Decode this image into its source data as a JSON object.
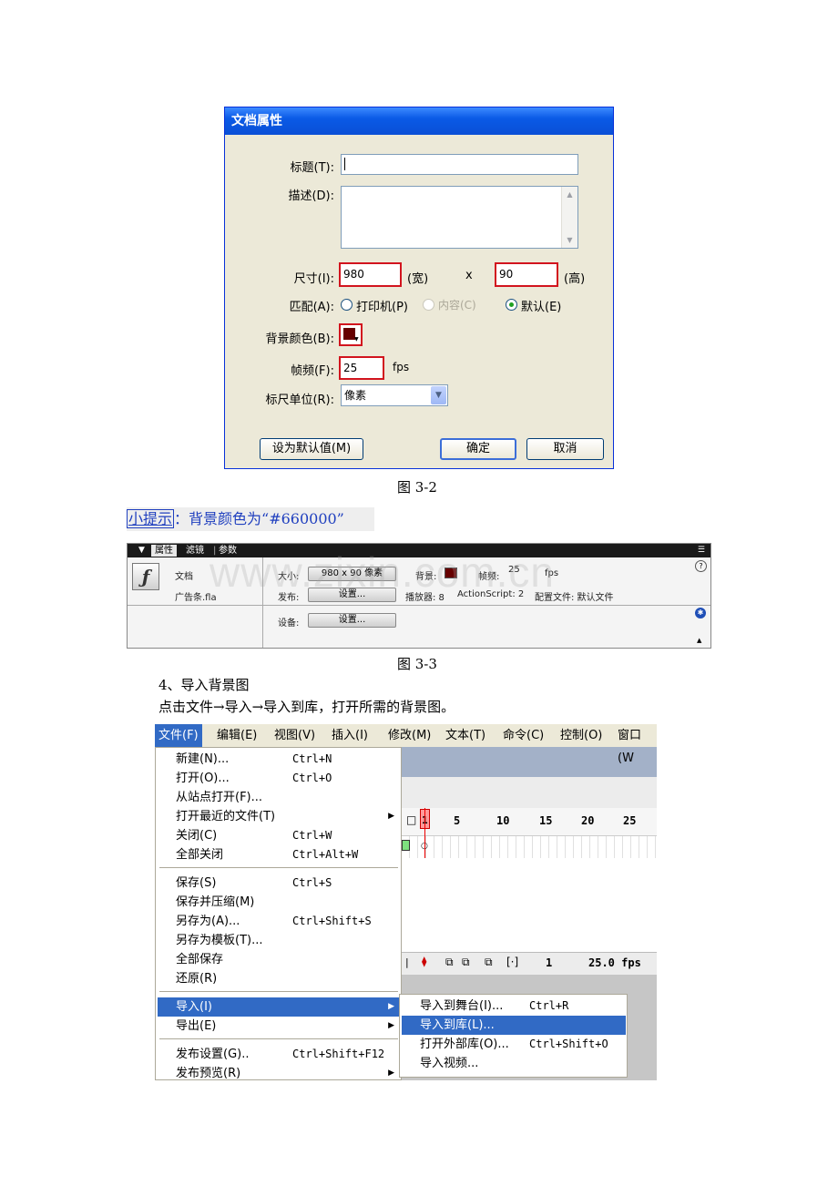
{
  "dialog": {
    "title": "文档属性",
    "title_label": "标题(T):",
    "title_value": "",
    "desc_label": "描述(D):",
    "desc_value": "",
    "size_label": "尺寸(I):",
    "width": "980",
    "width_unit": "(宽)",
    "times": "x",
    "height": "90",
    "height_unit": "(高)",
    "match_label": "匹配(A):",
    "match_options": [
      "打印机(P)",
      "内容(C)",
      "默认(E)"
    ],
    "match_selected": "默认(E)",
    "bg_label": "背景颜色(B):",
    "bg_color": "#660000",
    "fps_label": "帧频(F):",
    "fps": "25",
    "fps_unit": "fps",
    "ruler_label": "标尺单位(R):",
    "ruler_value": "像素",
    "default_button": "设为默认值(M)",
    "ok_button": "确定",
    "cancel_button": "取消"
  },
  "caption1": "图  3-2",
  "tip": {
    "label": "小提示",
    "text": "：背景颜色为“#660000”"
  },
  "panel": {
    "tabs": [
      "属性",
      "滤镜",
      "参数"
    ],
    "doc_type": "文档",
    "file_name": "广告条.fla",
    "size_label": "大小:",
    "size_button": "980 x 90 像素",
    "bg_label": "背景:",
    "fps_label": "帧频:",
    "fps": "25",
    "fps_unit": "fps",
    "publish_label": "发布:",
    "settings_button": "设置...",
    "player": "播放器: 8",
    "actionscript": "ActionScript: 2",
    "profile": "配置文件: 默认文件",
    "device_label": "设备:",
    "device_button": "设置...",
    "watermark": "www.zixin.com.cn"
  },
  "caption2": "图  3-3",
  "step_heading": "4、导入背景图",
  "step_text": "点击文件→导入→导入到库，打开所需的背景图。",
  "menubar": [
    "文件(F)",
    "编辑(E)",
    "视图(V)",
    "插入(I)",
    "修改(M)",
    "文本(T)",
    "命令(C)",
    "控制(O)",
    "窗口(W"
  ],
  "file_menu": [
    {
      "label": "新建(N)...",
      "shortcut": "Ctrl+N"
    },
    {
      "label": "打开(O)...",
      "shortcut": "Ctrl+O"
    },
    {
      "label": "从站点打开(F)...",
      "shortcut": ""
    },
    {
      "label": "打开最近的文件(T)",
      "shortcut": ""
    },
    {
      "label": "关闭(C)",
      "shortcut": "Ctrl+W"
    },
    {
      "label": "全部关闭",
      "shortcut": "Ctrl+Alt+W"
    },
    {
      "label": "保存(S)",
      "shortcut": "Ctrl+S"
    },
    {
      "label": "保存并压缩(M)",
      "shortcut": ""
    },
    {
      "label": "另存为(A)...",
      "shortcut": "Ctrl+Shift+S"
    },
    {
      "label": "另存为模板(T)...",
      "shortcut": ""
    },
    {
      "label": "全部保存",
      "shortcut": ""
    },
    {
      "label": "还原(R)",
      "shortcut": ""
    },
    {
      "label": "导入(I)",
      "shortcut": ""
    },
    {
      "label": "导出(E)",
      "shortcut": ""
    },
    {
      "label": "发布设置(G)..",
      "shortcut": "Ctrl+Shift+F12"
    },
    {
      "label": "发布预览(R)",
      "shortcut": ""
    }
  ],
  "import_submenu": [
    {
      "label": "导入到舞台(I)...",
      "shortcut": "Ctrl+R"
    },
    {
      "label": "导入到库(L)...",
      "shortcut": ""
    },
    {
      "label": "打开外部库(O)...",
      "shortcut": "Ctrl+Shift+O"
    },
    {
      "label": "导入视频...",
      "shortcut": ""
    }
  ],
  "timeline": {
    "frame_numbers": [
      "1",
      "5",
      "10",
      "15",
      "20",
      "25"
    ],
    "current_frame": "1",
    "fps_display": "25.0 fps"
  }
}
